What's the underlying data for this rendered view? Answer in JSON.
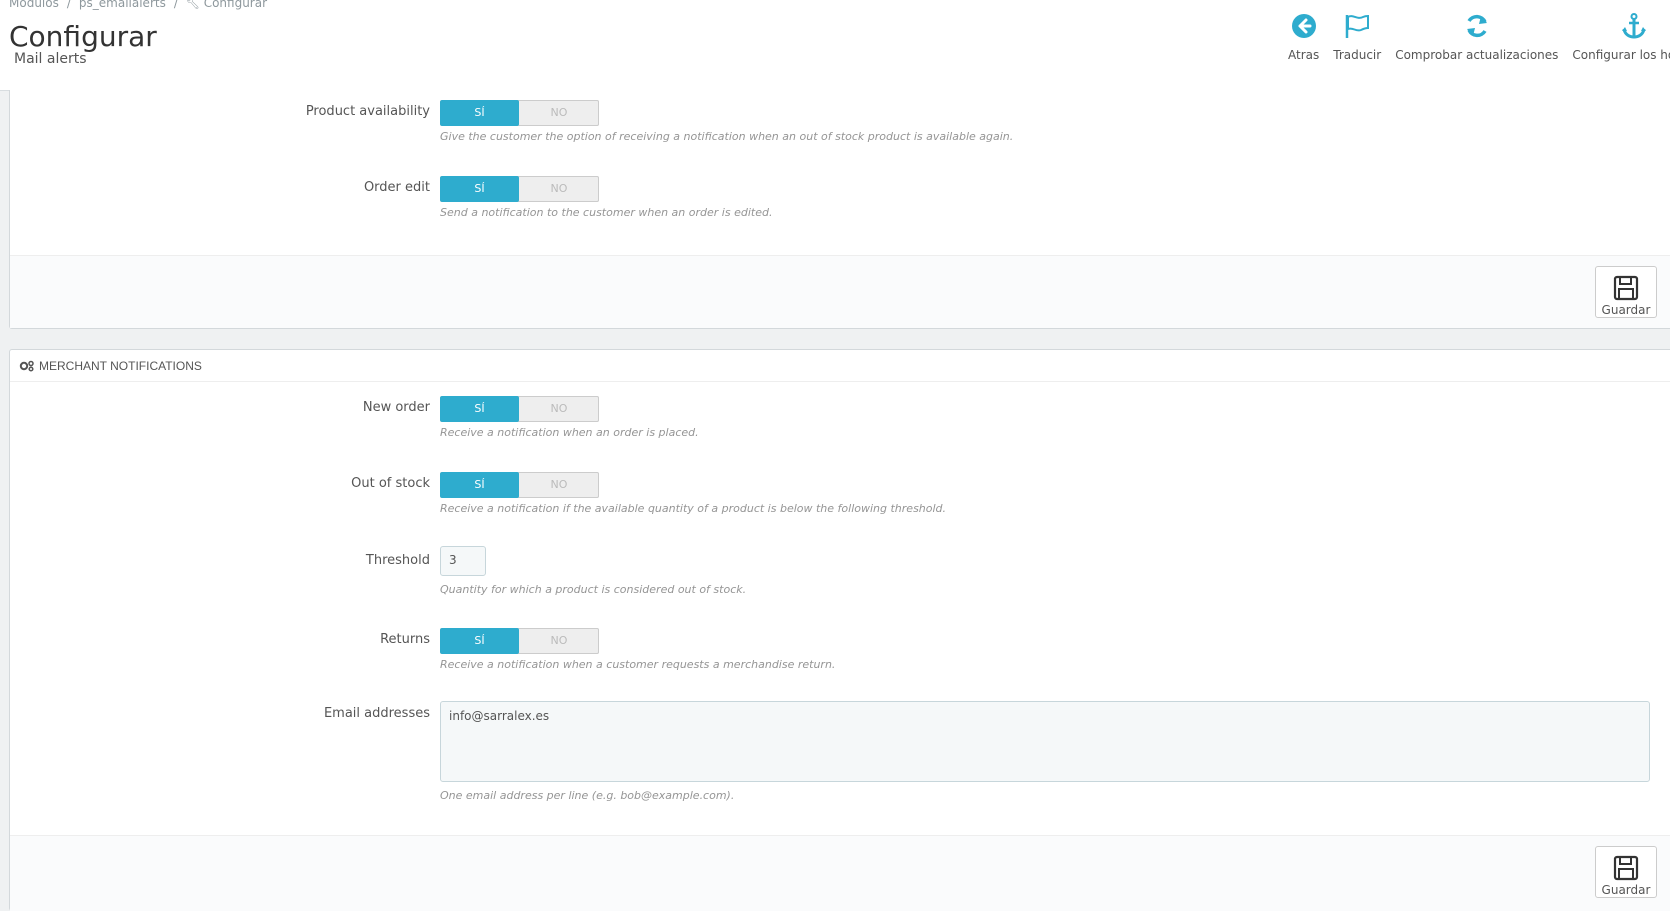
{
  "breadcrumb": {
    "item1": "Módulos",
    "item2": "ps_emailalerts",
    "item3": "Configurar"
  },
  "page": {
    "title": "Configurar",
    "subtitle": "Mail alerts"
  },
  "toolbar": {
    "back": "Atras",
    "translate": "Traducir",
    "check_updates": "Comprobar actualizaciones",
    "hooks": "Configurar los hooks"
  },
  "customer_panel": {
    "product_availability": {
      "label": "Product availability",
      "on": "SÍ",
      "off": "NO",
      "help": "Give the customer the option of receiving a notification when an out of stock product is available again."
    },
    "order_edit": {
      "label": "Order edit",
      "on": "SÍ",
      "off": "NO",
      "help": "Send a notification to the customer when an order is edited."
    },
    "save": "Guardar"
  },
  "merchant_panel": {
    "heading": "MERCHANT NOTIFICATIONS",
    "new_order": {
      "label": "New order",
      "on": "SÍ",
      "off": "NO",
      "help": "Receive a notification when an order is placed."
    },
    "out_of_stock": {
      "label": "Out of stock",
      "on": "SÍ",
      "off": "NO",
      "help": "Receive a notification if the available quantity of a product is below the following threshold."
    },
    "threshold": {
      "label": "Threshold",
      "value": "3",
      "help": "Quantity for which a product is considered out of stock."
    },
    "returns": {
      "label": "Returns",
      "on": "SÍ",
      "off": "NO",
      "help": "Receive a notification when a customer requests a merchandise return."
    },
    "emails": {
      "label": "Email addresses",
      "value": "info@sarralex.es",
      "help": "One email address per line (e.g. bob@example.com)."
    },
    "save": "Guardar"
  },
  "colors": {
    "accent": "#2eacce",
    "background": "#eff1f2"
  }
}
